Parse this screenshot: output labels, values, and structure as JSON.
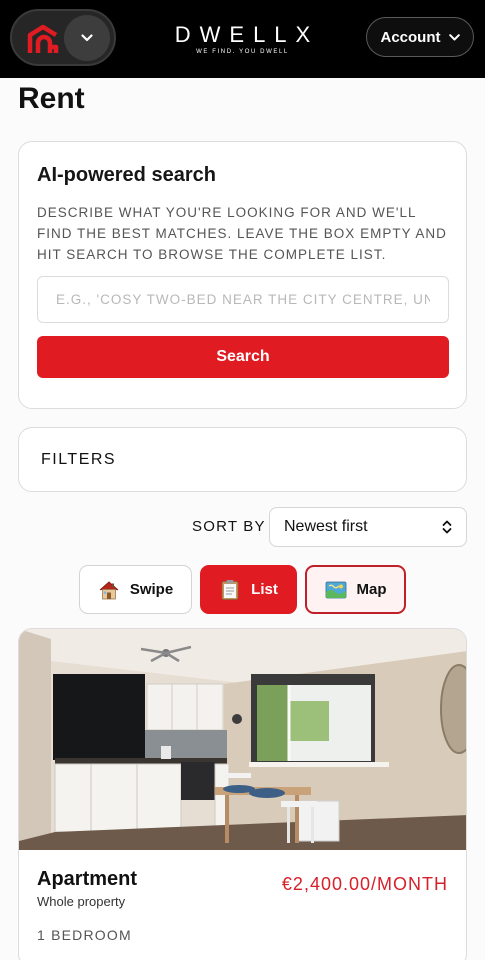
{
  "header": {
    "brand_name": "DWELLX",
    "tagline": "WE FIND. YOU DWELL",
    "account_label": "Account"
  },
  "page": {
    "title": "Rent"
  },
  "ai_search": {
    "title": "AI-powered search",
    "description": "Describe what you're looking for and we'll find the best matches. Leave the box empty and hit search to browse the complete list.",
    "placeholder": "E.G., 'COSY TWO-BED NEAR THE CITY CENTRE, UNI",
    "value": "",
    "button_label": "Search"
  },
  "filters": {
    "label": "FILTERS"
  },
  "sort": {
    "label": "SORT BY",
    "selected": "Newest first"
  },
  "views": {
    "swipe_label": "Swipe",
    "list_label": "List",
    "map_label": "Map",
    "active": "List"
  },
  "listing": {
    "type": "Apartment",
    "subtitle": "Whole property",
    "price": "€2,400.00/MONTH",
    "bedrooms": "1 BEDROOM"
  },
  "colors": {
    "accent": "#e01b22",
    "price": "#d6202a",
    "topbar": "#000000"
  },
  "icons": {
    "logo": "brand-logo",
    "menu": "chevron-down-icon",
    "account": "chevron-down-icon",
    "sort": "up-down-chevron-icon",
    "swipe": "house-icon",
    "list": "clipboard-icon",
    "map": "map-icon"
  }
}
